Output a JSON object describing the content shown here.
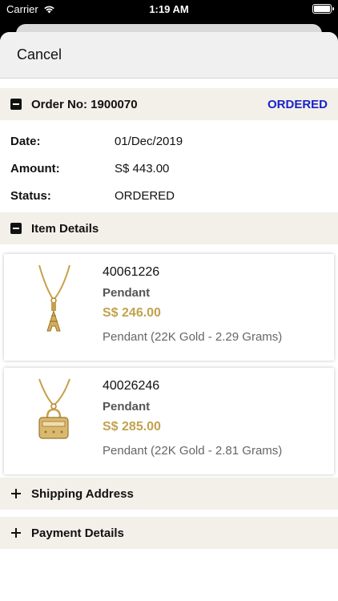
{
  "status_bar": {
    "carrier": "Carrier",
    "time": "1:19 AM"
  },
  "nav": {
    "cancel_label": "Cancel"
  },
  "order": {
    "title": "Order No: 1900070",
    "status_badge": "ORDERED",
    "rows": [
      {
        "label": "Date:",
        "value": "01/Dec/2019"
      },
      {
        "label": "Amount:",
        "value": "S$ 443.00"
      },
      {
        "label": "Status:",
        "value": "ORDERED"
      }
    ]
  },
  "item_details": {
    "title": "Item Details",
    "items": [
      {
        "code": "40061226",
        "type": "Pendant",
        "price": "S$ 246.00",
        "description": "Pendant (22K Gold - 2.29 Grams)"
      },
      {
        "code": "40026246",
        "type": "Pendant",
        "price": "S$ 285.00",
        "description": "Pendant (22K Gold - 2.81 Grams)"
      }
    ]
  },
  "shipping": {
    "title": "Shipping Address"
  },
  "payment": {
    "title": "Payment Details"
  },
  "colors": {
    "accent_blue": "#1a21c8",
    "price_gold": "#c2a24e",
    "section_bg": "#f3f0ea"
  },
  "icons": {
    "collapse": "minus-square-icon",
    "expand": "plus-icon"
  }
}
